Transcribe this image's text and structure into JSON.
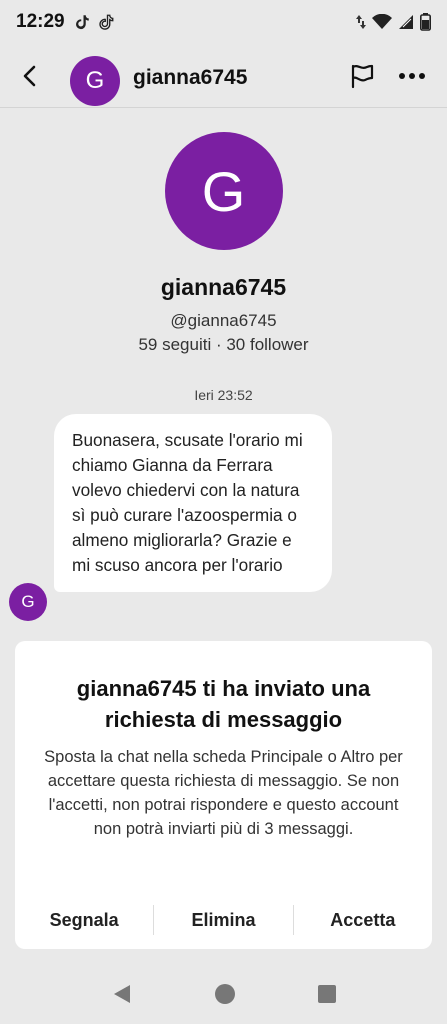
{
  "status_bar": {
    "time": "12:29"
  },
  "header": {
    "username": "gianna6745",
    "avatar_letter": "G"
  },
  "profile": {
    "avatar_letter": "G",
    "name": "gianna6745",
    "handle": "@gianna6745",
    "stats": "59 seguiti · 30 follower"
  },
  "chat": {
    "timestamp": "Ieri 23:52",
    "message": "Buonasera, scusate l'orario mi chiamo Gianna da Ferrara volevo chiedervi con la natura sì può curare l'azoospermia o almeno migliorarla? Grazie e mi scuso ancora per l'orario",
    "sender_avatar_letter": "G"
  },
  "request": {
    "title": "gianna6745 ti ha inviato una richiesta di messaggio",
    "body": "Sposta la chat nella scheda Principale o Altro per accettare questa richiesta di messaggio. Se non l'accetti, non potrai rispondere e questo account non potrà inviarti più di 3 messaggi.",
    "report_label": "Segnala",
    "delete_label": "Elimina",
    "accept_label": "Accetta"
  },
  "colors": {
    "avatar": "#7b1fa2",
    "background": "#e9e9e9"
  },
  "icons": [
    "back-arrow-icon",
    "flag-icon",
    "more-icon",
    "tiktok-icon",
    "wifi-icon",
    "signal-icon",
    "battery-icon"
  ]
}
